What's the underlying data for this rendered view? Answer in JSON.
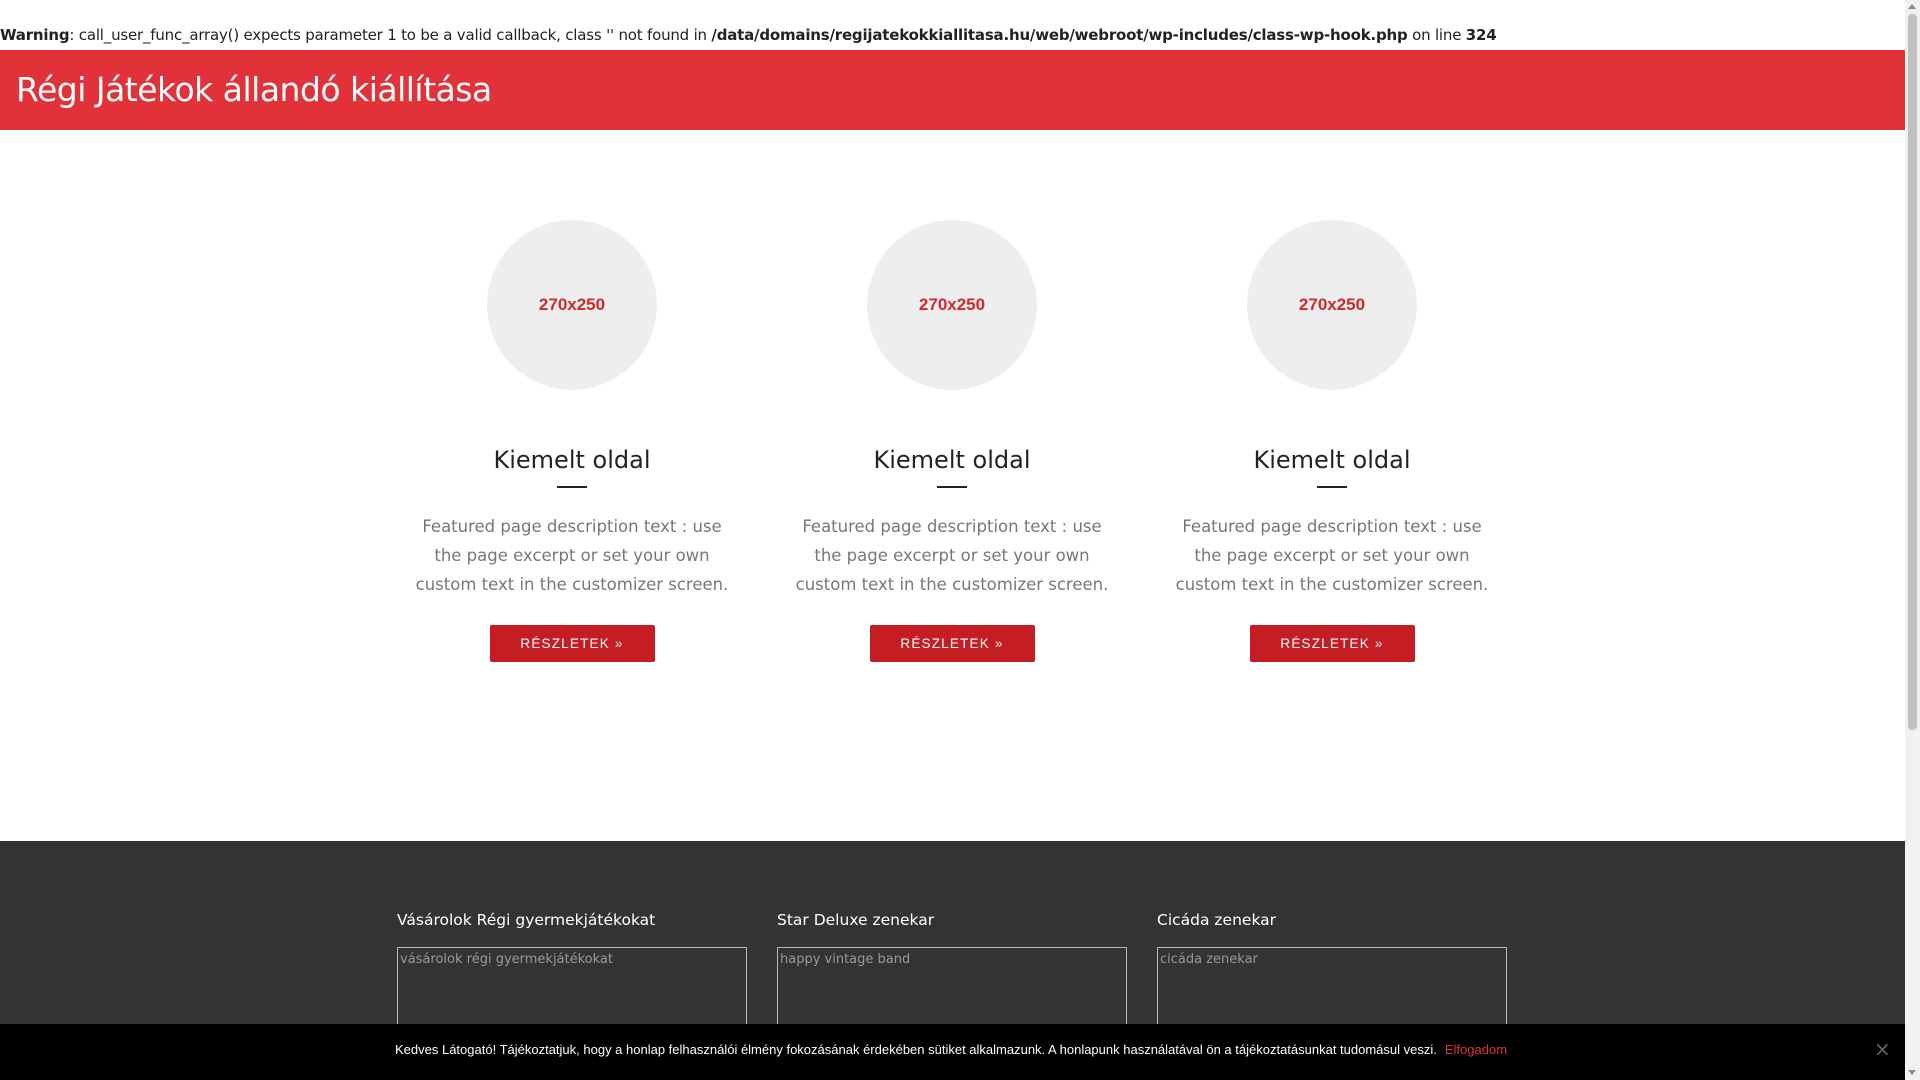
{
  "warning": {
    "label": "Warning",
    "message": ": call_user_func_array() expects parameter 1 to be a valid callback, class '' not found in ",
    "path": "/data/domains/regijatekokkiallitasa.hu/web/webroot/wp-includes/class-wp-hook.php",
    "on_line_text": " on line ",
    "line": "324"
  },
  "header": {
    "site_title": "Régi Játékok állandó kiállítása",
    "bg_color": "#e03238"
  },
  "featured": {
    "items": [
      {
        "thumb_text": "270x250",
        "title": "Kiemelt oldal",
        "description": "Featured page description text : use the page excerpt or set your own custom text in the customizer screen.",
        "button": "RÉSZLETEK »"
      },
      {
        "thumb_text": "270x250",
        "title": "Kiemelt oldal",
        "description": "Featured page description text : use the page excerpt or set your own custom text in the customizer screen.",
        "button": "RÉSZLETEK »"
      },
      {
        "thumb_text": "270x250",
        "title": "Kiemelt oldal",
        "description": "Featured page description text : use the page excerpt or set your own custom text in the customizer screen.",
        "button": "RÉSZLETEK »"
      }
    ]
  },
  "footer": {
    "widgets": [
      {
        "title": "Vásárolok Régi gyermekjátékokat",
        "img_alt": "vásárolok régi gyermekjátékokat"
      },
      {
        "title": "Star Deluxe zenekar",
        "img_alt": "happy vintage band"
      },
      {
        "title": "Cicáda zenekar",
        "img_alt": "cicáda zenekar"
      }
    ]
  },
  "cookie": {
    "text": "Kedves Látogató! Tájékoztatjuk, hogy a honlap felhasználói élmény fokozásának érdekében sütiket alkalmazunk. A honlapunk használatával ön a tájékoztatásunkat tudomásul veszi.",
    "accept": "Elfogadom",
    "close": "×"
  },
  "colors": {
    "accent": "#e03238",
    "button": "#c41e24",
    "footer_bg": "#333333",
    "cookie_bg": "#000000"
  }
}
